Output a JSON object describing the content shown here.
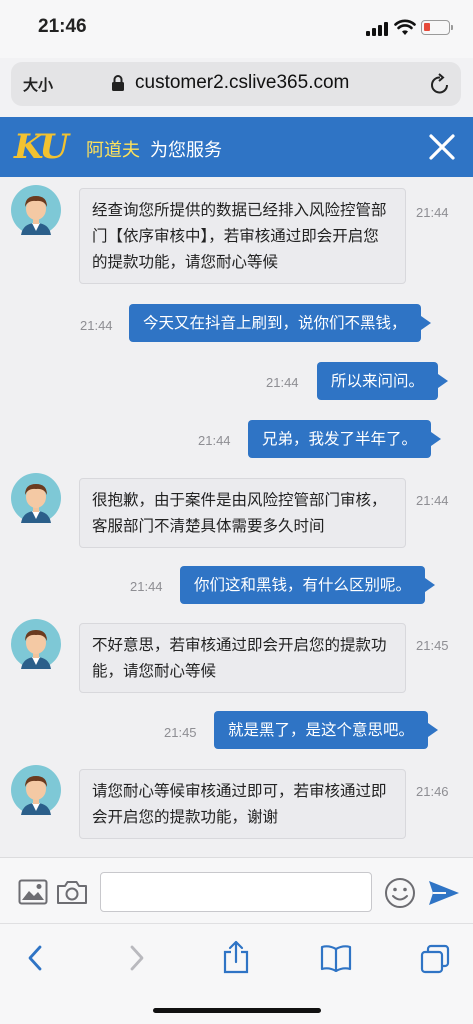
{
  "status_bar": {
    "time": "21:46"
  },
  "browser": {
    "text_size_label": "大小",
    "url": "customer2.cslive365.com"
  },
  "chat_header": {
    "logo": "KU",
    "agent_name": "阿道夫",
    "serve_text": "为您服务"
  },
  "messages": [
    {
      "side": "in",
      "time": "21:44",
      "text": "经查询您所提供的数据已经排入风险控管部门【依序审核中】，若审核通过即会开启您的提款功能，请您耐心等候"
    },
    {
      "side": "out",
      "time": "21:44",
      "text": "今天又在抖音上刷到，说你们不黑钱，"
    },
    {
      "side": "out",
      "time": "21:44",
      "text": "所以来问问。"
    },
    {
      "side": "out",
      "time": "21:44",
      "text": "兄弟，我发了半年了。"
    },
    {
      "side": "in",
      "time": "21:44",
      "text": "很抱歉，由于案件是由风险控管部门审核，客服部门不清楚具体需要多久时间"
    },
    {
      "side": "out",
      "time": "21:44",
      "text": "你们这和黑钱，有什么区别呢。"
    },
    {
      "side": "in",
      "time": "21:45",
      "text": "不好意思，若审核通过即会开启您的提款功能，请您耐心等候"
    },
    {
      "side": "out",
      "time": "21:45",
      "text": "就是黑了，是这个意思吧。"
    },
    {
      "side": "in",
      "time": "21:46",
      "text": "请您耐心等候审核通过即可，若审核通过即会开启您的提款功能，谢谢"
    }
  ],
  "composer": {
    "input_value": "",
    "icons": [
      "image-icon",
      "camera-icon",
      "emoji-icon",
      "send-icon"
    ]
  },
  "toolbar": {
    "icons": [
      "back-icon",
      "forward-icon",
      "share-icon",
      "bookmarks-icon",
      "tabs-icon"
    ]
  },
  "colors": {
    "accent": "#2f74c5",
    "agent_name": "#ffe25a",
    "battery_low": "#e64a3a"
  }
}
